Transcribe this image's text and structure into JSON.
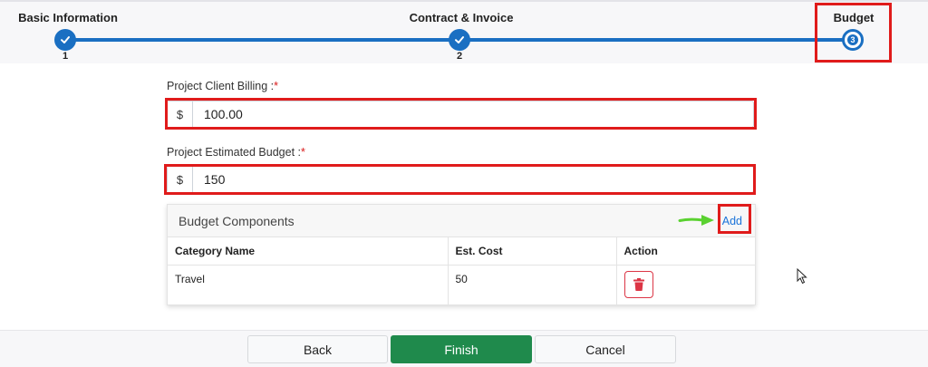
{
  "stepper": {
    "steps": [
      {
        "title": "Basic Information",
        "number": "1",
        "state": "done"
      },
      {
        "title": "Contract & Invoice",
        "number": "2",
        "state": "done"
      },
      {
        "title": "Budget",
        "number": "3",
        "state": "current"
      }
    ],
    "accent": "#1a6fc2"
  },
  "form": {
    "client_billing": {
      "label": "Project Client Billing :",
      "required_mark": "*",
      "prefix": "$",
      "value": "100.00"
    },
    "estimated_budget": {
      "label": "Project Estimated Budget :",
      "required_mark": "*",
      "prefix": "$",
      "value": "150"
    }
  },
  "budget_components": {
    "title": "Budget Components",
    "add_label": "Add",
    "columns": [
      "Category Name",
      "Est. Cost",
      "Action"
    ],
    "rows": [
      {
        "category": "Travel",
        "cost": "50"
      }
    ]
  },
  "footer": {
    "back_label": "Back",
    "finish_label": "Finish",
    "cancel_label": "Cancel"
  },
  "colors": {
    "highlight": "#e01b1b",
    "finish_button": "#1f8a4c",
    "link": "#1a73d9"
  }
}
